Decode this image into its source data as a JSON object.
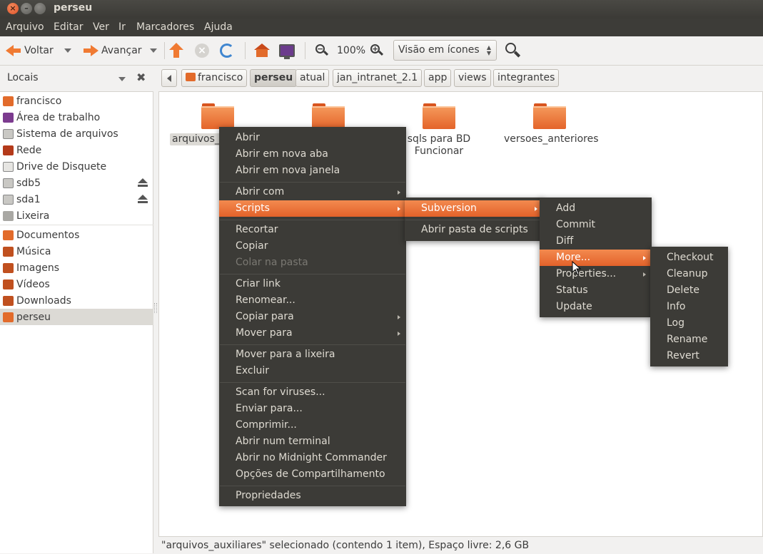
{
  "window": {
    "title": "perseu"
  },
  "menubar": [
    "Arquivo",
    "Editar",
    "Ver",
    "Ir",
    "Marcadores",
    "Ajuda"
  ],
  "toolbar": {
    "back_label": "Voltar",
    "forward_label": "Avançar",
    "zoom_level": "100%",
    "view_mode": "Visão em ícones"
  },
  "sidebar": {
    "title": "Locais",
    "items": [
      {
        "label": "francisco",
        "icon": "home-folder-icon",
        "color": "#e26b2b"
      },
      {
        "label": "Área de trabalho",
        "icon": "desktop-icon",
        "color": "#7c3b8f"
      },
      {
        "label": "Sistema de arquivos",
        "icon": "harddisk-icon",
        "color": "#9a9a96"
      },
      {
        "label": "Rede",
        "icon": "network-icon",
        "color": "#b43a1a"
      },
      {
        "label": "Drive de Disquete",
        "icon": "floppy-icon",
        "color": "#8a8a86"
      },
      {
        "label": "sdb5",
        "icon": "harddisk-icon",
        "color": "#9a9a96"
      },
      {
        "label": "sda1",
        "icon": "harddisk-icon",
        "color": "#9a9a96"
      },
      {
        "label": "Lixeira",
        "icon": "trash-icon",
        "color": "#8a8a86"
      },
      {
        "label": "Documentos",
        "icon": "folder-icon",
        "color": "#e26b2b"
      },
      {
        "label": "Música",
        "icon": "music-folder-icon",
        "color": "#c0501f"
      },
      {
        "label": "Imagens",
        "icon": "pictures-folder-icon",
        "color": "#c0501f"
      },
      {
        "label": "Vídeos",
        "icon": "videos-folder-icon",
        "color": "#c0501f"
      },
      {
        "label": "Downloads",
        "icon": "downloads-folder-icon",
        "color": "#c0501f"
      },
      {
        "label": "perseu",
        "icon": "folder-icon",
        "color": "#e26b2b"
      }
    ]
  },
  "breadcrumb": [
    "francisco",
    "perseu",
    "atual",
    "jan_intranet_2.1",
    "app",
    "views",
    "integrantes"
  ],
  "files": [
    {
      "name": "arquivos_auxiliares",
      "visible_label": "arquivos_a"
    },
    {
      "name": "",
      "visible_label": ""
    },
    {
      "name": "sqls para BD",
      "line2": "Funcionar"
    },
    {
      "name": "versoes_anteriores"
    }
  ],
  "context_menu": {
    "items": [
      "Abrir",
      "Abrir em nova aba",
      "Abrir em nova janela",
      "Abrir com",
      "Scripts",
      "Recortar",
      "Copiar",
      "Colar na pasta",
      "Criar link",
      "Renomear...",
      "Copiar para",
      "Mover para",
      "Mover para a lixeira",
      "Excluir",
      "Scan for viruses...",
      "Enviar para...",
      "Comprimir...",
      "Abrir num terminal",
      "Abrir no Midnight Commander",
      "Opções de Compartilhamento",
      "Propriedades"
    ]
  },
  "scripts_menu": {
    "items": [
      "Subversion",
      "Abrir pasta de scripts"
    ]
  },
  "svn_menu": {
    "items": [
      "Add",
      "Commit",
      "Diff",
      "More...",
      "Properties...",
      "Status",
      "Update"
    ]
  },
  "more_menu": {
    "items": [
      "Checkout",
      "Cleanup",
      "Delete",
      "Info",
      "Log",
      "Rename",
      "Revert"
    ]
  },
  "statusbar": {
    "text": "\"arquivos_auxiliares\" selecionado (contendo 1 item), Espaço livre: 2,6 GB"
  },
  "colors": {
    "accent": "#e3622a",
    "menu_bg": "#3c3b37",
    "titlebar": "#3b3a36"
  }
}
